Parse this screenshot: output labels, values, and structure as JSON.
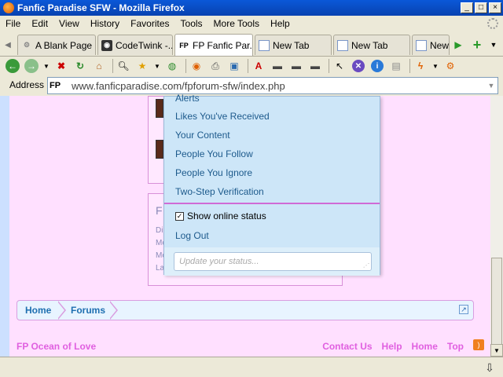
{
  "window": {
    "title": "Fanfic Paradise SFW - Mozilla Firefox",
    "controls": [
      "_",
      "□",
      "×"
    ]
  },
  "menubar": {
    "items": [
      "File",
      "Edit",
      "View",
      "History",
      "Favorites",
      "Tools",
      "More Tools",
      "Help"
    ]
  },
  "tabs": [
    {
      "label": "A Blank Page",
      "icon": "page-icon"
    },
    {
      "label": "CodeTwink -...",
      "icon": "codetwink-icon"
    },
    {
      "label": "FP Fanfic Par...",
      "icon": "fp-icon",
      "active": true
    },
    {
      "label": "New Tab",
      "icon": "page-icon"
    },
    {
      "label": "New Tab",
      "icon": "page-icon"
    },
    {
      "label": "New",
      "icon": "page-icon"
    }
  ],
  "address": {
    "label": "Address",
    "url": "www.fanficparadise.com/fpforum-sfw/index.php",
    "favicon": "FP"
  },
  "dropdown": {
    "items": [
      "Alerts",
      "Likes You've Received",
      "Your Content",
      "People You Follow",
      "People You Ignore",
      "Two-Step Verification"
    ],
    "show_online_status": "Show online status",
    "logout": "Log Out",
    "status_placeholder": "Update your status..."
  },
  "breadcrumb": {
    "items": [
      "Home",
      "Forums"
    ]
  },
  "footer": {
    "left": "FP Ocean of Love",
    "links": [
      "Contact Us",
      "Help",
      "Home",
      "Top"
    ]
  },
  "background_faded": {
    "f": "F",
    "rows": [
      "Di",
      "Me",
      "Me",
      "La"
    ]
  },
  "colors": {
    "accent": "#e060e0",
    "link": "#1e6fb0",
    "page_bg": "#ffe0ff",
    "dropdown_bg": "#cde6f8"
  }
}
